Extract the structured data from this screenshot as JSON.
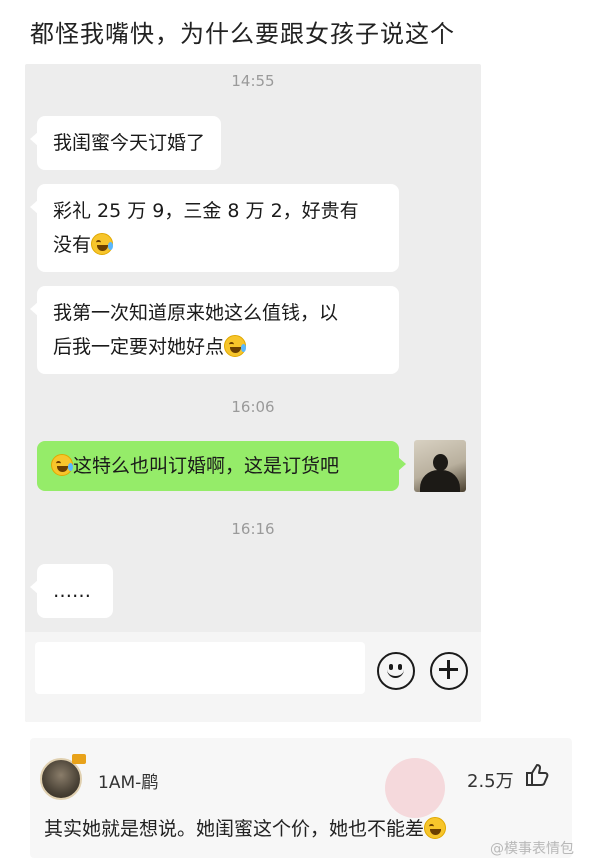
{
  "post": {
    "title": "都怪我嘴快，为什么要跟女孩子说这个"
  },
  "chat": {
    "timestamps": [
      "14:55",
      "16:06",
      "16:16"
    ],
    "messages": [
      {
        "text": "我闺蜜今天订婚了"
      },
      {
        "line1": "彩礼 25 万 9，三金 8 万 2，好贵有",
        "line2": "没有"
      },
      {
        "line1": "我第一次知道原来她这么值钱，以",
        "line2": "后我一定要对她好点"
      },
      {
        "text": "这特么也叫订婚啊，这是订货吧"
      },
      {
        "text": "……"
      }
    ],
    "emoji_icon": "laughing-crying-emoji"
  },
  "comment": {
    "username": "1AM-鹛",
    "likes": "2.5万",
    "text": "其实她就是想说。她闺蜜这个价，她也不能差"
  },
  "watermark": "@模事表情包",
  "colors": {
    "sent_bubble": "#95ec69",
    "chat_background": "#ededed"
  }
}
